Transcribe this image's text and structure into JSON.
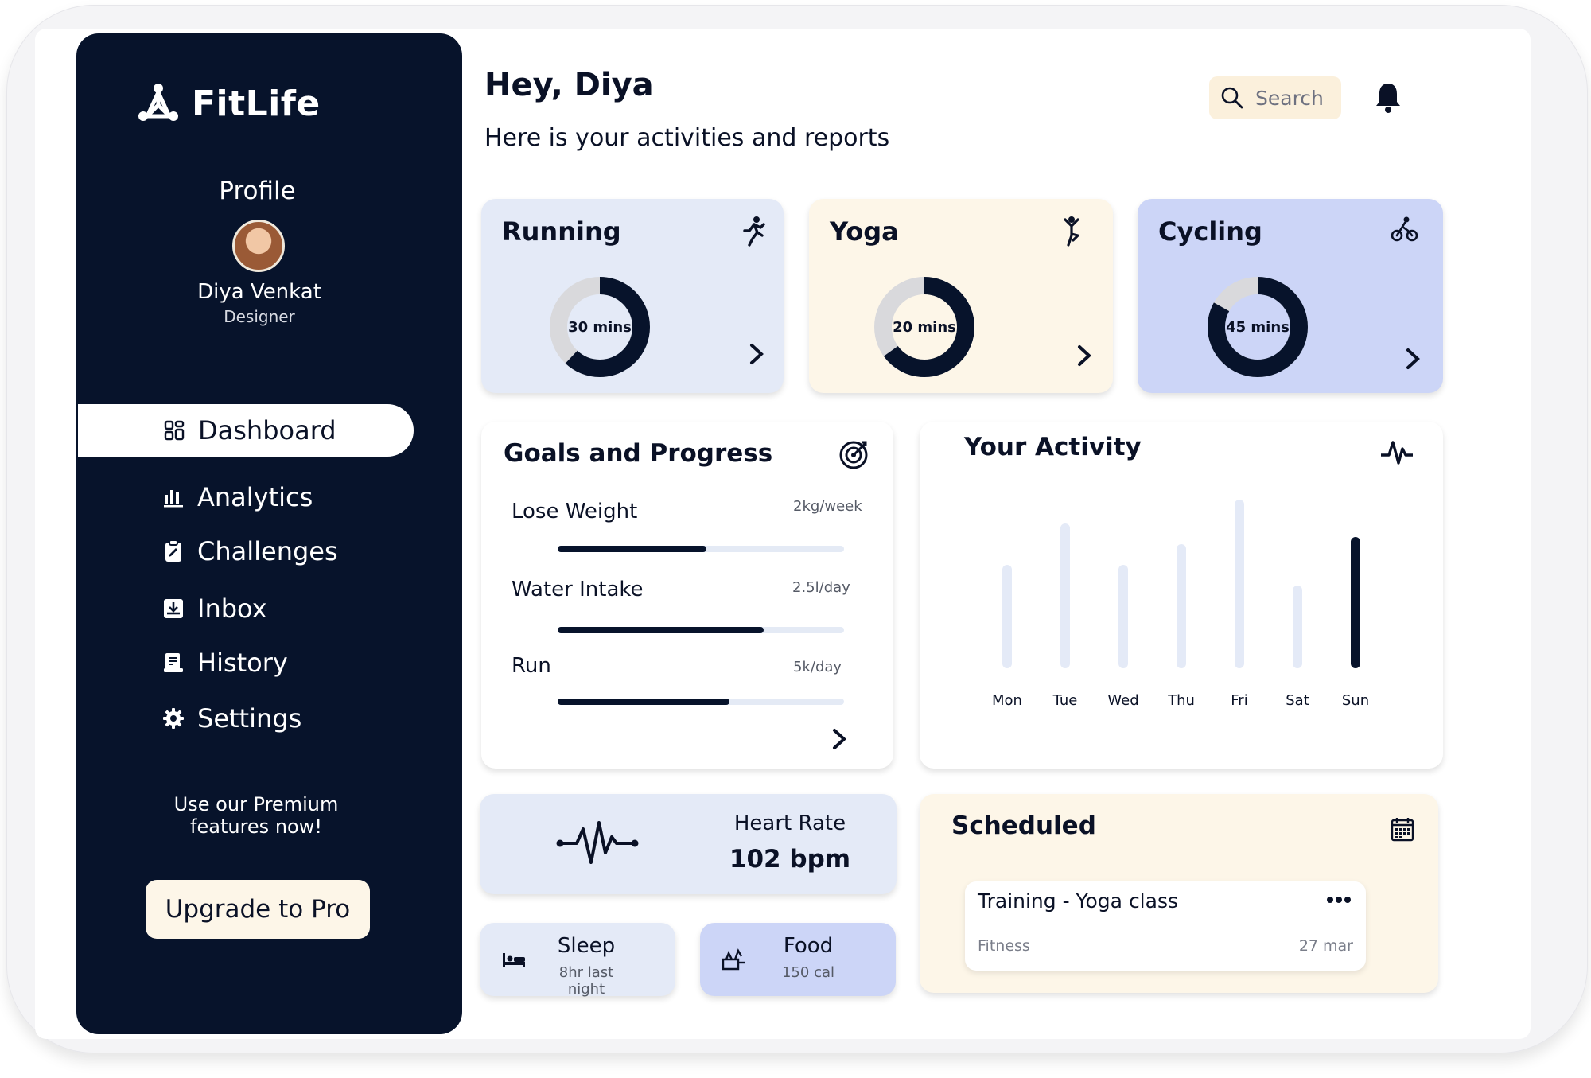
{
  "app": {
    "name": "FitLife"
  },
  "sidebar": {
    "profile_title": "Profile",
    "user": {
      "name": "Diya Venkat",
      "role": "Designer"
    },
    "nav": [
      {
        "label": "Dashboard",
        "icon": "grid-icon",
        "active": true
      },
      {
        "label": "Analytics",
        "icon": "bar-chart-icon"
      },
      {
        "label": "Challenges",
        "icon": "clipboard-icon"
      },
      {
        "label": "Inbox",
        "icon": "inbox-icon"
      },
      {
        "label": "History",
        "icon": "history-icon"
      },
      {
        "label": "Settings",
        "icon": "gear-icon"
      }
    ],
    "premium_text_1": "Use our Premium",
    "premium_text_2": "features now!",
    "upgrade_label": "Upgrade to Pro"
  },
  "header": {
    "greeting": "Hey, Diya",
    "subtitle": "Here is your activities and reports",
    "search_placeholder": "Search"
  },
  "activities": [
    {
      "title": "Running",
      "minutes_label": "30 mins",
      "progress": 0.62,
      "bg": "#e4eaf7",
      "icon": "running-icon"
    },
    {
      "title": "Yoga",
      "minutes_label": "20 mins",
      "progress": 0.65,
      "bg": "#fdf6e8",
      "icon": "yoga-icon"
    },
    {
      "title": "Cycling",
      "minutes_label": "45 mins",
      "progress": 0.83,
      "bg": "#ccd5f7",
      "icon": "cycling-icon"
    }
  ],
  "goals": {
    "title": "Goals and Progress",
    "items": [
      {
        "label": "Lose Weight",
        "target": "2kg/week",
        "progress": 0.52
      },
      {
        "label": "Water Intake",
        "target": "2.5l/day",
        "progress": 0.72
      },
      {
        "label": "Run",
        "target": "5k/day",
        "progress": 0.6
      }
    ]
  },
  "activity_chart": {
    "title": "Your Activity",
    "chart_data": {
      "type": "bar",
      "title": "Your Activity",
      "categories": [
        "Mon",
        "Tue",
        "Wed",
        "Thu",
        "Fri",
        "Sat",
        "Sun"
      ],
      "values": [
        130,
        182,
        130,
        156,
        212,
        104,
        165
      ],
      "highlight": "Sun",
      "colors": {
        "normal": "#e4eaf7",
        "highlight": "#07132b"
      },
      "grid": false
    }
  },
  "heart_rate": {
    "label": "Heart Rate",
    "value": "102 bpm"
  },
  "sleep": {
    "title": "Sleep",
    "subtitle": "8hr last night"
  },
  "food": {
    "title": "Food",
    "subtitle": "150 cal"
  },
  "scheduled": {
    "title": "Scheduled",
    "item": {
      "title": "Training - Yoga class",
      "category": "Fitness",
      "date": "27 mar"
    }
  },
  "colors": {
    "navy": "#07132b",
    "light_blue": "#e4eaf7",
    "cream": "#fdf6e8",
    "periwinkle": "#ccd5f7",
    "search_bg": "#fbf0dc"
  }
}
